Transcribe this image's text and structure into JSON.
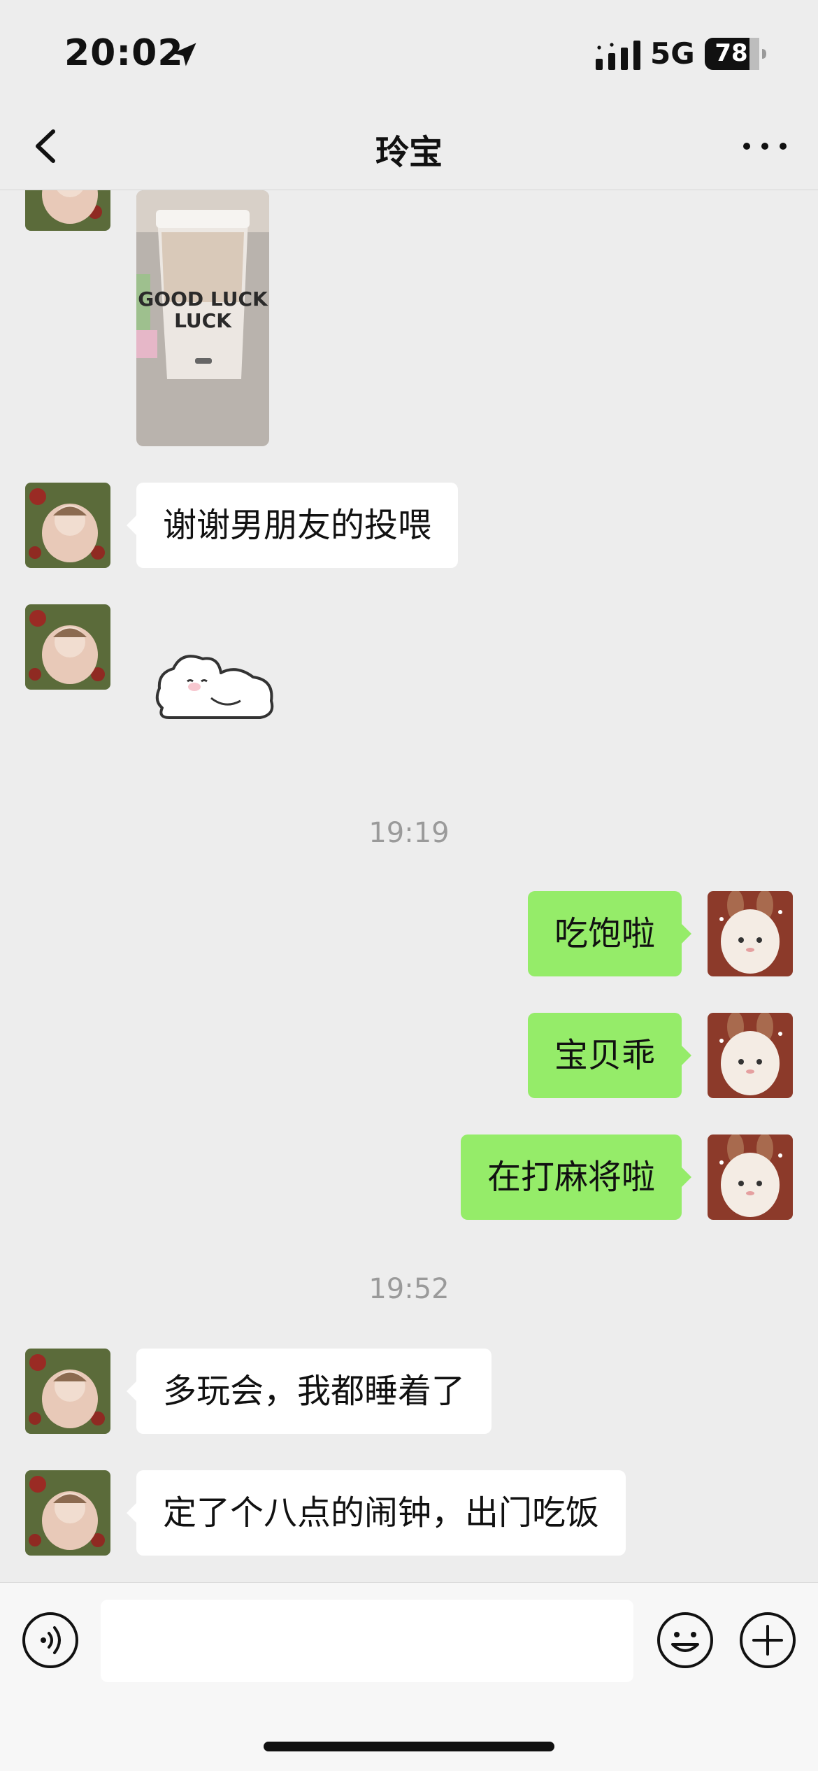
{
  "status_bar": {
    "time": "20:02",
    "network": "5G",
    "battery": "78",
    "icons": [
      "location-arrow-icon",
      "signal-icon",
      "battery-icon"
    ]
  },
  "nav": {
    "title": "玲宝",
    "back_icon": "chevron-left-icon",
    "more_icon": "more-dots-icon"
  },
  "chat": {
    "photo_text": "GOOD LUCK",
    "messages": [
      {
        "side": "in",
        "type": "text",
        "text": "谢谢男朋友的投喂"
      },
      {
        "side": "in",
        "type": "sticker",
        "sticker": "sleepy-bunny-sticker"
      },
      {
        "type": "timestamp",
        "text": "19:19"
      },
      {
        "side": "out",
        "type": "text",
        "text": "吃饱啦"
      },
      {
        "side": "out",
        "type": "text",
        "text": "宝贝乖"
      },
      {
        "side": "out",
        "type": "text",
        "text": "在打麻将啦"
      },
      {
        "type": "timestamp",
        "text": "19:52"
      },
      {
        "side": "in",
        "type": "text",
        "text": "多玩会，我都睡着了"
      },
      {
        "side": "in",
        "type": "text",
        "text": "定了个八点的闹钟，出门吃饭"
      }
    ]
  },
  "input_bar": {
    "placeholder": "",
    "voice_icon": "voice-icon",
    "emoji_icon": "emoji-icon",
    "plus_icon": "plus-icon"
  },
  "colors": {
    "background": "#ededed",
    "bubble_out": "#95ec69",
    "bubble_in": "#ffffff",
    "timestamp": "#9a9a9a"
  }
}
